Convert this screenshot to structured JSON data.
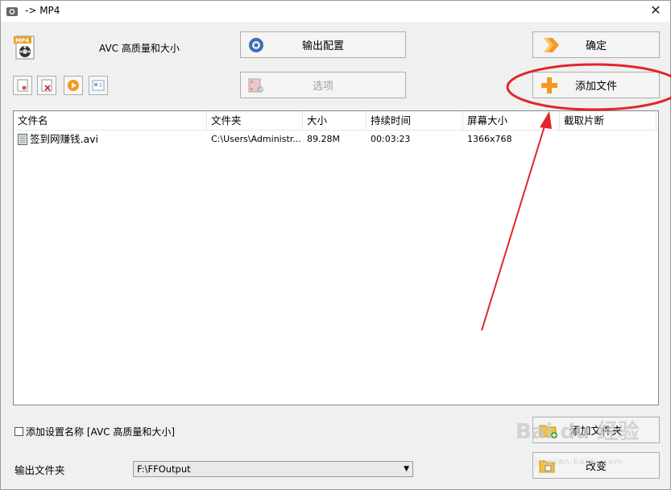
{
  "window": {
    "title": "-> MP4",
    "close_glyph": "✕"
  },
  "profile": {
    "name": "AVC 高质量和大小",
    "icon": "mp4-file-icon"
  },
  "buttons": {
    "output_config": "输出配置",
    "confirm": "确定",
    "options": "选项",
    "add_file": "添加文件",
    "add_folder": "添加文件夹",
    "change": "改变"
  },
  "file_list": {
    "columns": [
      "文件名",
      "文件夹",
      "大小",
      "持续时间",
      "屏幕大小",
      "截取片断"
    ],
    "rows": [
      {
        "name": "签到网赚钱.avi",
        "folder": "C:\\Users\\Administr...",
        "size": "89.28M",
        "duration": "00:03:23",
        "screen": "1366x768",
        "clip": ""
      }
    ]
  },
  "add_setting_name": {
    "label": "添加设置名称 [AVC 高质量和大小]",
    "checked": false
  },
  "output_folder": {
    "label": "输出文件夹",
    "value": "F:\\FFOutput"
  },
  "watermark": {
    "text": "Bai du 经验",
    "sub": "jingyan.baidu.com"
  },
  "colors": {
    "annotation_red": "#e0262a",
    "accent_orange": "#f39a1e"
  }
}
